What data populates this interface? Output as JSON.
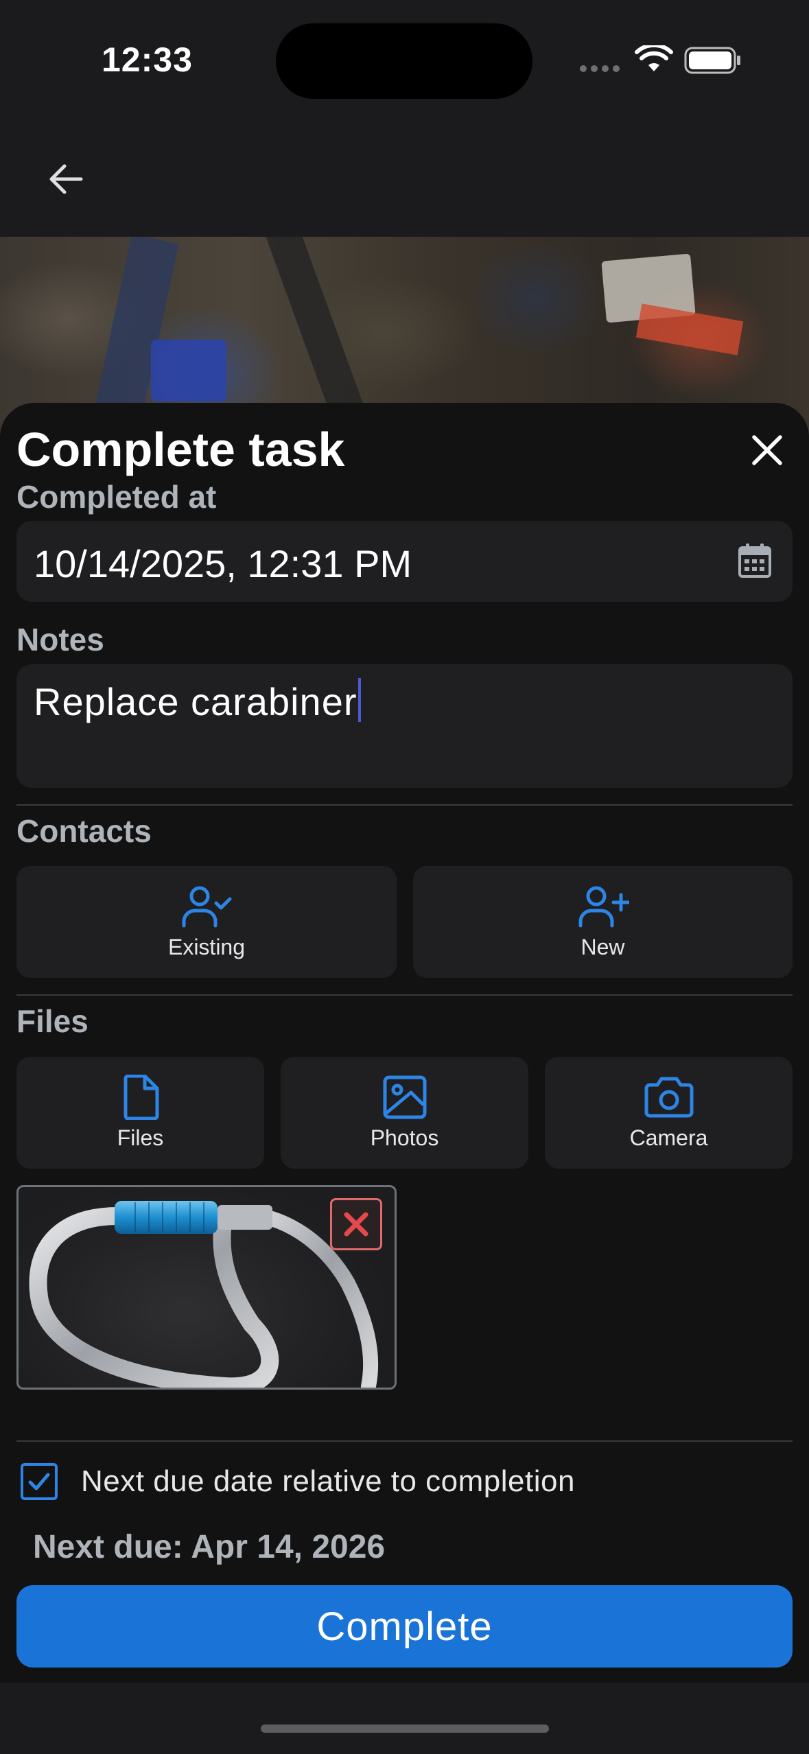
{
  "status_bar": {
    "time": "12:33"
  },
  "nav": {
    "back_icon": "arrow-left-icon"
  },
  "sheet": {
    "title": "Complete task",
    "close_icon": "close-icon",
    "completed_at": {
      "label": "Completed at",
      "value": "10/14/2025, 12:31 PM",
      "icon": "calendar-icon"
    },
    "notes": {
      "label": "Notes",
      "value": "Replace carabiner"
    },
    "contacts": {
      "label": "Contacts",
      "buttons": [
        {
          "label": "Existing",
          "icon": "user-check-icon"
        },
        {
          "label": "New",
          "icon": "user-plus-icon"
        }
      ]
    },
    "files": {
      "label": "Files",
      "buttons": [
        {
          "label": "Files",
          "icon": "file-icon"
        },
        {
          "label": "Photos",
          "icon": "image-icon"
        },
        {
          "label": "Camera",
          "icon": "camera-icon"
        }
      ],
      "attachment": {
        "remove_icon": "remove-x-icon"
      }
    },
    "relative_due": {
      "label": "Next due date relative to completion",
      "checked": true
    },
    "next_due": "Next due: Apr 14, 2026",
    "complete_button": "Complete"
  },
  "colors": {
    "accent": "#1a73d6",
    "icon_blue": "#2d85e6",
    "sheet_bg": "#121212",
    "field_bg": "#1f1f21",
    "label_gray": "#aeb4ba",
    "remove_red": "#e06a6a"
  }
}
